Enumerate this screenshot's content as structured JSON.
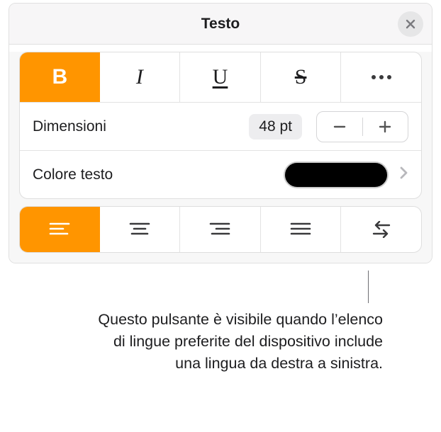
{
  "header": {
    "title": "Testo"
  },
  "style": {
    "bold_active": true,
    "size_label": "Dimensioni",
    "size_value": "48 pt",
    "color_label": "Colore testo",
    "color_swatch": "#000000"
  },
  "align": {
    "active_index": 0
  },
  "callout": "Questo pulsante è visibile quando l’elenco di lingue preferite del dispositivo include una lingua da destra a sinistra."
}
